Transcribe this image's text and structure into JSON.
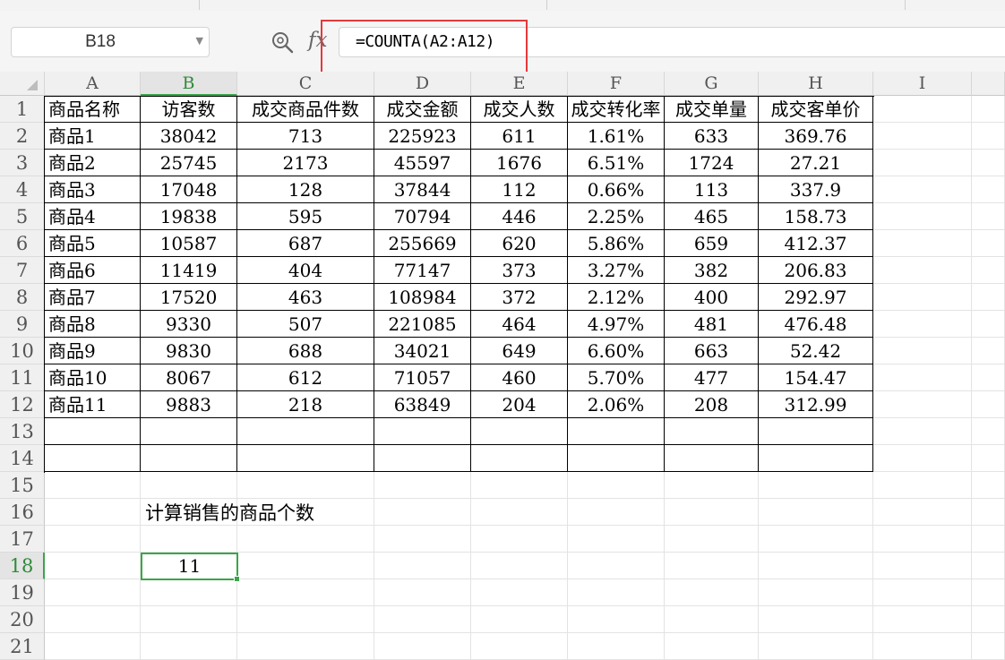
{
  "formula_bar": {
    "name_box": "B18",
    "fx_label": "fx",
    "formula": "=COUNTA(A2:A12)"
  },
  "columns": [
    "A",
    "B",
    "C",
    "D",
    "E",
    "F",
    "G",
    "H",
    "I"
  ],
  "rows": [
    "1",
    "2",
    "3",
    "4",
    "5",
    "6",
    "7",
    "8",
    "9",
    "10",
    "11",
    "12",
    "13",
    "14",
    "15",
    "16",
    "17",
    "18",
    "19",
    "20",
    "21"
  ],
  "table": {
    "headers": [
      "商品名称",
      "访客数",
      "成交商品件数",
      "成交金额",
      "成交人数",
      "成交转化率",
      "成交单量",
      "成交客单价"
    ],
    "rows": [
      [
        "商品1",
        "38042",
        "713",
        "225923",
        "611",
        "1.61%",
        "633",
        "369.76"
      ],
      [
        "商品2",
        "25745",
        "2173",
        "45597",
        "1676",
        "6.51%",
        "1724",
        "27.21"
      ],
      [
        "商品3",
        "17048",
        "128",
        "37844",
        "112",
        "0.66%",
        "113",
        "337.9"
      ],
      [
        "商品4",
        "19838",
        "595",
        "70794",
        "446",
        "2.25%",
        "465",
        "158.73"
      ],
      [
        "商品5",
        "10587",
        "687",
        "255669",
        "620",
        "5.86%",
        "659",
        "412.37"
      ],
      [
        "商品6",
        "11419",
        "404",
        "77147",
        "373",
        "3.27%",
        "382",
        "206.83"
      ],
      [
        "商品7",
        "17520",
        "463",
        "108984",
        "372",
        "2.12%",
        "400",
        "292.97"
      ],
      [
        "商品8",
        "9330",
        "507",
        "221085",
        "464",
        "4.97%",
        "481",
        "476.48"
      ],
      [
        "商品9",
        "9830",
        "688",
        "34021",
        "649",
        "6.60%",
        "663",
        "52.42"
      ],
      [
        "商品10",
        "8067",
        "612",
        "71057",
        "460",
        "5.70%",
        "477",
        "154.47"
      ],
      [
        "商品11",
        "9883",
        "218",
        "63849",
        "204",
        "2.06%",
        "208",
        "312.99"
      ]
    ]
  },
  "note": "计算销售的商品个数",
  "result": "11"
}
